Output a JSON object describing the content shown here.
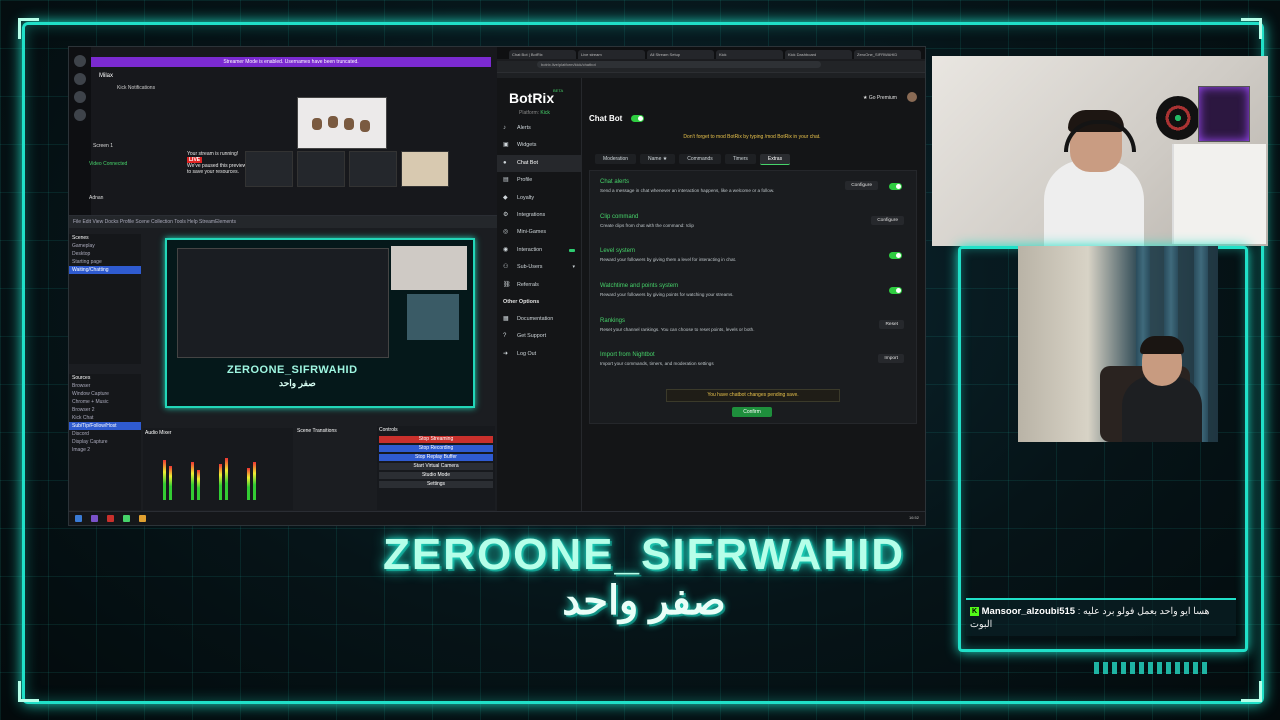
{
  "overlay": {
    "channel_name": "ZEROONE_SIFRWAHID",
    "channel_name_arabic": "صفر واحد",
    "accent_color": "#20e0c8"
  },
  "chat": {
    "badge_icon": "kick-icon",
    "username": "Mansoor_alzoubi515",
    "message": "هسا ايو واحد بعمل فولو برد عليه : البوت"
  },
  "discord": {
    "server_name": "Milax",
    "streamer_banner": "Streamer Mode is enabled. Usernames have been truncated.",
    "channel_item": "Kick Notifications",
    "stream_card_title": "Your stream is running!",
    "live_badge": "LIVE",
    "stream_card_text": "We've paused this preview to save your resources.",
    "voice_status": "Video Connected",
    "user": "Adnan",
    "screen_label": "Screen 1"
  },
  "obs": {
    "menu": "File  Edit  View  Docks  Profile  Scene Collection  Tools  Help  StreamElements",
    "scenes_header": "Scenes",
    "scenes": [
      "Gameplay",
      "Desktop",
      "Starting page",
      "Waiting/Chatting"
    ],
    "sources_header": "Sources",
    "sources": [
      "Browser",
      "Window Capture",
      "Chrome + Music",
      "Browser 2",
      "Kick Chat",
      "Sub/Tip/Follow/Host",
      "Discord",
      "Display Capture",
      "Image 2"
    ],
    "preview_title": "ZEROONE_SIFRWAHID",
    "preview_title_arabic": "صفر واحد",
    "mixer_header": "Audio Mixer",
    "transitions_header": "Scene Transitions",
    "controls_header": "Controls",
    "controls": [
      "Stop Streaming",
      "Stop Recording",
      "Stop Replay Buffer",
      "Start Virtual Camera",
      "Studio Mode",
      "Settings"
    ]
  },
  "browser": {
    "tabs": [
      "Chat Bot | BotRix",
      "Live stream",
      "All Stream Setup",
      "Kick",
      "Kick Dashboard",
      "ZeroOne_SIFRWAHID"
    ],
    "url": "botrix.live/platform/kick/chatbot"
  },
  "botrix": {
    "brand": "BotRix",
    "beta": "BETA",
    "platform_label": "Platform:",
    "platform_value": "Kick",
    "premium_label": "Go Premium",
    "nav": [
      {
        "label": "Alerts",
        "icon": "bell-icon",
        "active": false
      },
      {
        "label": "Widgets",
        "icon": "widget-icon",
        "active": false
      },
      {
        "label": "Chat Bot",
        "icon": "chat-icon",
        "active": true
      },
      {
        "label": "Profile",
        "icon": "profile-icon",
        "active": false
      },
      {
        "label": "Loyalty",
        "icon": "loyalty-icon",
        "active": false
      },
      {
        "label": "Integrations",
        "icon": "integrations-icon",
        "active": false
      },
      {
        "label": "Mini-Games",
        "icon": "games-icon",
        "active": false
      },
      {
        "label": "Interaction",
        "icon": "interaction-icon",
        "active": false
      },
      {
        "label": "Sub-Users",
        "icon": "users-icon",
        "active": false
      },
      {
        "label": "Referrals",
        "icon": "referrals-icon",
        "active": false
      }
    ],
    "other_options": "Other Options",
    "nav_other": [
      {
        "label": "Documentation",
        "icon": "doc-icon"
      },
      {
        "label": "Get Support",
        "icon": "support-icon"
      },
      {
        "label": "Log Out",
        "icon": "logout-icon"
      }
    ],
    "page_title": "Chat Bot",
    "warning": "Don't forget to mod BotRix by typing  /mod BotRix  in your chat.",
    "subtabs": [
      "Moderation",
      "Name ★",
      "Commands",
      "Timers",
      "Extras"
    ],
    "active_subtab": "Extras",
    "features": [
      {
        "name": "Chat alerts",
        "desc": "Send a message in chat whenever an interaction happens, like a welcome or a follow.",
        "action": "Configure",
        "toggle": true
      },
      {
        "name": "Clip command",
        "desc": "Create clips from chat with the command: !clip",
        "action": "Configure",
        "toggle": null
      },
      {
        "name": "Level system",
        "desc": "Reward your followers by giving them a level for interacting in chat.",
        "action": null,
        "toggle": true
      },
      {
        "name": "Watchtime and points system",
        "desc": "Reward your followers by giving points for watching your streams.",
        "action": null,
        "toggle": true
      },
      {
        "name": "Rankings",
        "desc": "Reset your channel rankings. You can choose to reset points, levels or both.",
        "action": "Reset",
        "toggle": null
      },
      {
        "name": "Import from Nightbot",
        "desc": "Import your commands, timers, and moderation settings",
        "action": "Import",
        "toggle": null
      }
    ],
    "pending_notice": "You have chatbot changes pending save.",
    "confirm_label": "Confirm",
    "toggle_color": "#2ecc40"
  },
  "taskbar": {
    "clock": "16:52"
  }
}
